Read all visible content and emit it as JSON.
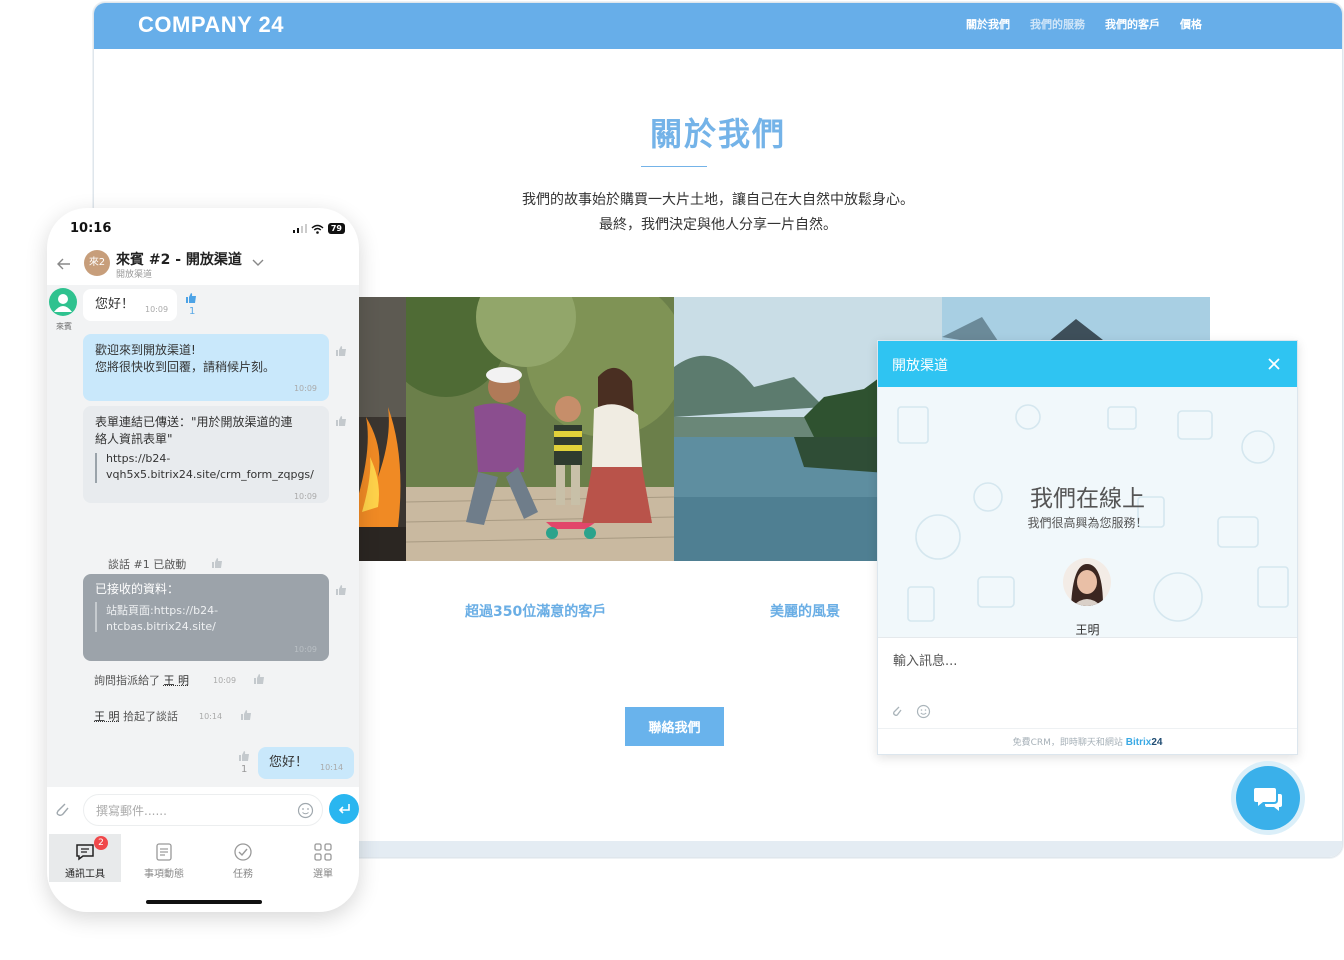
{
  "website": {
    "logo": "COMPANY 24",
    "nav": [
      "關於我們",
      "我們的服務",
      "我們的客戶",
      "價格"
    ],
    "about_title": "關於我們",
    "about_line1": "我們的故事始於購買一大片土地，讓自己在大自然中放鬆身心。",
    "about_line2": "最終，我們決定與他人分享一片自然。",
    "caption_customers": "超過350位滿意的客戶",
    "caption_scenery": "美麗的風景",
    "contact_button": "聯絡我們"
  },
  "widget": {
    "title": "開放渠道",
    "online": "我們在線上",
    "subtitle": "我們很高興為您服務！",
    "agent": "王明",
    "input_placeholder": "輸入訊息...",
    "footer_text": "免費CRM，即時聊天和網站",
    "brand": "Bitrix",
    "brand_num": "24",
    "close_icon": "close-icon",
    "fab_icon": "chat-bubbles-icon"
  },
  "phone": {
    "time": "10:16",
    "battery": "79",
    "avatar_text": "來2",
    "chat_title": "來賓 #2 - 開放渠道",
    "chat_subtitle": "開放渠道",
    "visitor_label": "來賓",
    "messages": {
      "hello1": "您好！",
      "hello1_time": "10:09",
      "hello1_likes": "1",
      "welcome_line1": "歡迎來到開放渠道!",
      "welcome_line2": "您將很快收到回覆，請稍候片刻。",
      "welcome_time": "10:09",
      "form_line1": "表單連結已傳送：\"用於開放渠道的連",
      "form_line2": "絡人資訊表單\"",
      "form_url1": "https://b24-",
      "form_url2": "vqh5x5.bitrix24.site/crm_form_zqpgs/",
      "form_time": "10:09",
      "session_started": "談話 #1 已啟動",
      "received_title": "已接收的資料：",
      "received_line1": "站點頁面:https://b24-",
      "received_line2": "ntcbas.bitrix24.site/",
      "received_time": "10:09",
      "assigned_text": "詢問指派給了",
      "assigned_agent": "王 明",
      "assigned_time": "10:09",
      "pickup_agent": "王 明",
      "pickup_text": "拾起了談話",
      "pickup_time": "10:14",
      "hello2": "您好！",
      "hello2_time": "10:14",
      "hello2_likes": "1"
    },
    "compose_placeholder": "撰寫郵件......",
    "tabs": [
      {
        "label": "通訊工具",
        "icon": "chat-icon",
        "badge": "2"
      },
      {
        "label": "事項動態",
        "icon": "feed-icon"
      },
      {
        "label": "任務",
        "icon": "task-check-icon"
      },
      {
        "label": "選單",
        "icon": "menu-grid-icon"
      }
    ]
  },
  "colors": {
    "site_bar": "#67aee9",
    "widget_header": "#2fc4f2",
    "accent": "#69b3ec"
  }
}
